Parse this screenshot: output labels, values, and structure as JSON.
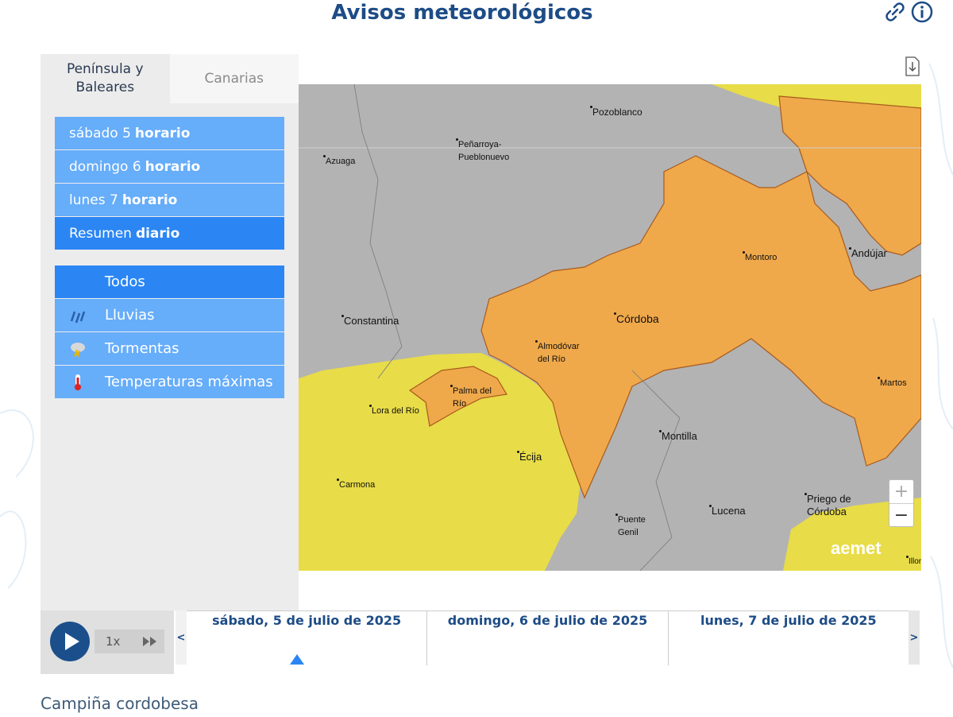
{
  "header": {
    "title": "Avisos meteorológicos",
    "link_icon": "link-icon",
    "info_icon": "info-icon"
  },
  "region_tabs": [
    {
      "label": "Península y\nBaleares",
      "active": true
    },
    {
      "label": "Canarias",
      "active": false
    }
  ],
  "days": [
    {
      "prefix": "sábado 5",
      "suffix": "horario",
      "active": false
    },
    {
      "prefix": "domingo 6",
      "suffix": "horario",
      "active": false
    },
    {
      "prefix": "lunes 7",
      "suffix": "horario",
      "active": false
    },
    {
      "prefix": "Resumen",
      "suffix": "diario",
      "active": true
    }
  ],
  "phenomena": [
    {
      "label": "Todos",
      "icon": "",
      "active": true
    },
    {
      "label": "Lluvias",
      "icon": "rain-icon",
      "active": false
    },
    {
      "label": "Tormentas",
      "icon": "storm-icon",
      "active": false
    },
    {
      "label": "Temperaturas máximas",
      "icon": "thermometer-icon",
      "active": false
    }
  ],
  "map": {
    "cities": [
      {
        "name": "Pozoblanco"
      },
      {
        "name": "Peñarroya-\nPueblonuevo"
      },
      {
        "name": "Azuaga"
      },
      {
        "name": "Montoro"
      },
      {
        "name": "Andújar"
      },
      {
        "name": "Constantina"
      },
      {
        "name": "Córdoba"
      },
      {
        "name": "Almodóvar\ndel Río"
      },
      {
        "name": "Palma del\nRío"
      },
      {
        "name": "Lora del Río"
      },
      {
        "name": "Martos"
      },
      {
        "name": "Montilla"
      },
      {
        "name": "Écija"
      },
      {
        "name": "Carmona"
      },
      {
        "name": "Lucena"
      },
      {
        "name": "Puente\nGenil"
      },
      {
        "name": "Priego de\nCórdoba"
      },
      {
        "name": "Illor"
      }
    ],
    "colors": {
      "no_warning": "#b3b3b3",
      "yellow": "#e8dc48",
      "orange": "#f0a94a",
      "border": "#a85a1e"
    },
    "zoom_in": "+",
    "zoom_out": "−",
    "logo": "aemet"
  },
  "timeline": {
    "speed": "1x",
    "days": [
      "sábado, 5 de julio de 2025",
      "domingo, 6 de julio de 2025",
      "lunes, 7 de julio de 2025"
    ],
    "prev": "<",
    "next": ">"
  },
  "zone_name": "Campiña cordobesa"
}
